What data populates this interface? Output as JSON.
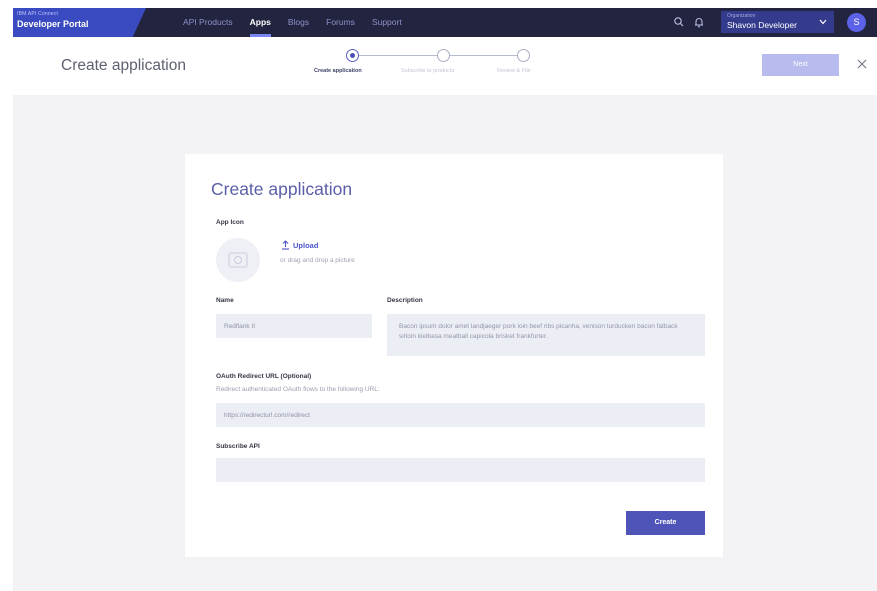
{
  "header": {
    "brand_small": "IBM API Connect",
    "brand_name": "Developer Portal",
    "nav": [
      "API Products",
      "Apps",
      "Blogs",
      "Forums",
      "Support"
    ],
    "active_nav": "Apps",
    "org_label": "Organization",
    "org_name": "Shavon Developer",
    "avatar_initial": "S"
  },
  "subheader": {
    "title": "Create application",
    "steps": [
      "Create application",
      "Subscribe to products",
      "Review & File"
    ],
    "active_step": 0,
    "next_label": "Next"
  },
  "form": {
    "title": "Create application",
    "app_icon_label": "App Icon",
    "upload_label": "Upload",
    "drop_hint": "or drag and drop a picture",
    "name_label": "Name",
    "name_value": "Redflank II",
    "description_label": "Description",
    "description_value": "Bacon ipsum dolor amet landjaeger pork loin beef ribs picanha, venison turducken bacon fatback sirloin kielbasa meatball capicola brisket frankfurter.",
    "oauth_label": "OAuth Redirect URL (Optional)",
    "oauth_hint": "Redirect authenticated OAuth flows to the following URL:",
    "oauth_value": "https://redirecturl.com/redirect",
    "subscribe_label": "Subscribe API",
    "subscribe_value": "",
    "create_label": "Create"
  },
  "colors": {
    "nav_bg": "#23243f",
    "brand_bg": "#3a4ac0",
    "accent": "#4f54b8",
    "next_disabled": "#b7bbee",
    "page_bg": "#f3f3f6"
  }
}
